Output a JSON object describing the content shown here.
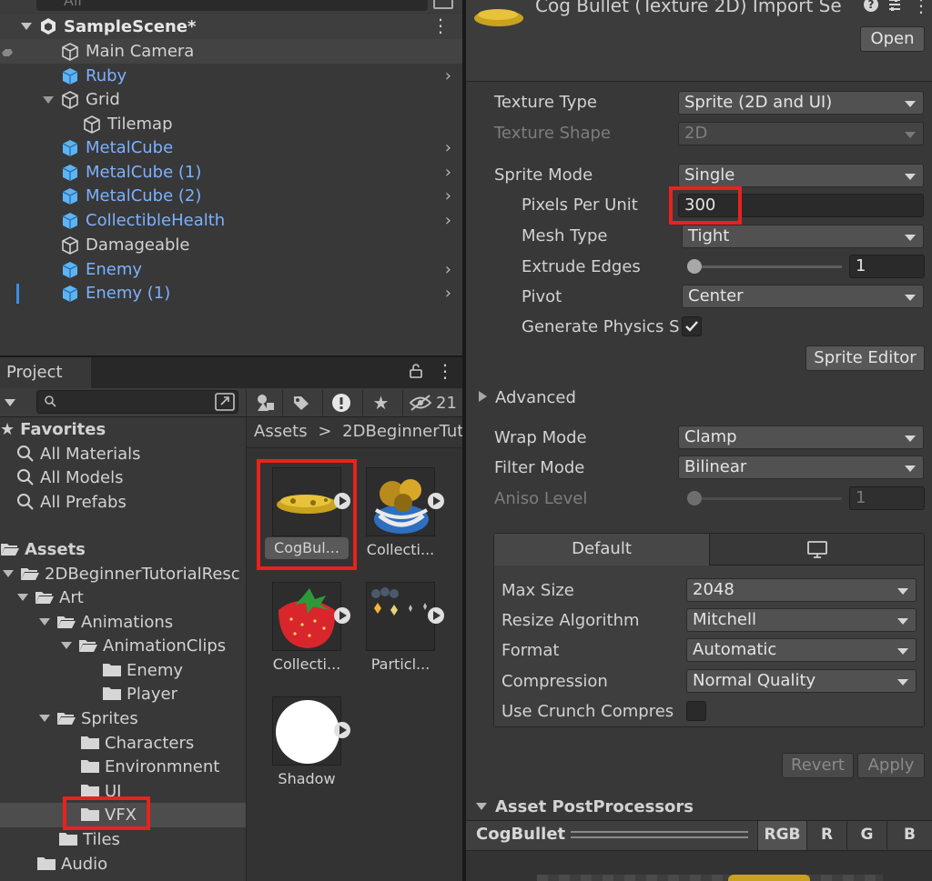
{
  "hierarchy": {
    "search_placeholder": "All",
    "scene": "SampleScene*",
    "items": [
      {
        "label": "Main Camera",
        "prefab": false
      },
      {
        "label": "Ruby",
        "prefab": true
      },
      {
        "label": "Grid",
        "prefab": false
      },
      {
        "label": "Tilemap",
        "prefab": false
      },
      {
        "label": "MetalCube",
        "prefab": true
      },
      {
        "label": "MetalCube (1)",
        "prefab": true
      },
      {
        "label": "MetalCube (2)",
        "prefab": true
      },
      {
        "label": "CollectibleHealth",
        "prefab": true
      },
      {
        "label": "Damageable",
        "prefab": false
      },
      {
        "label": "Enemy",
        "prefab": true
      },
      {
        "label": "Enemy (1)",
        "prefab": true
      }
    ]
  },
  "project": {
    "tab": "Project",
    "hidden_count": "21",
    "favorites": {
      "label": "Favorites",
      "items": [
        "All Materials",
        "All Models",
        "All Prefabs"
      ]
    },
    "tree": {
      "assets": "Assets",
      "items": [
        "2DBeginnerTutorialResc",
        "Art",
        "Animations",
        "AnimationClips",
        "Enemy",
        "Player",
        "Sprites",
        "Characters",
        "Environmnent",
        "UI",
        "VFX",
        "Tiles",
        "Audio"
      ]
    },
    "breadcrumb": {
      "root": "Assets",
      "sep": ">",
      "path": "2DBeginnerTut"
    },
    "assets": [
      {
        "label": "CogBul..."
      },
      {
        "label": "Collecti..."
      },
      {
        "label": "Collecti..."
      },
      {
        "label": "Particl..."
      },
      {
        "label": "Shadow"
      }
    ]
  },
  "inspector": {
    "title": "Cog Bullet (Texture 2D) Import Se",
    "open_label": "Open",
    "texture_type": {
      "label": "Texture Type",
      "value": "Sprite (2D and UI)"
    },
    "texture_shape": {
      "label": "Texture Shape",
      "value": "2D"
    },
    "sprite_mode": {
      "label": "Sprite Mode",
      "value": "Single"
    },
    "pixels_per_unit": {
      "label": "Pixels Per Unit",
      "value": "300"
    },
    "mesh_type": {
      "label": "Mesh Type",
      "value": "Tight"
    },
    "extrude_edges": {
      "label": "Extrude Edges",
      "value": "1"
    },
    "pivot": {
      "label": "Pivot",
      "value": "Center"
    },
    "generate_physics": {
      "label": "Generate Physics S",
      "checked": true
    },
    "sprite_editor_label": "Sprite Editor",
    "advanced_label": "Advanced",
    "wrap_mode": {
      "label": "Wrap Mode",
      "value": "Clamp"
    },
    "filter_mode": {
      "label": "Filter Mode",
      "value": "Bilinear"
    },
    "aniso_level": {
      "label": "Aniso Level",
      "value": "1"
    },
    "platform": {
      "default_tab": "Default",
      "max_size": {
        "label": "Max Size",
        "value": "2048"
      },
      "resize_algorithm": {
        "label": "Resize Algorithm",
        "value": "Mitchell"
      },
      "format": {
        "label": "Format",
        "value": "Automatic"
      },
      "compression": {
        "label": "Compression",
        "value": "Normal Quality"
      },
      "use_crunch": {
        "label": "Use Crunch Compres",
        "checked": false
      }
    },
    "revert_label": "Revert",
    "apply_label": "Apply",
    "postprocessors_label": "Asset PostProcessors",
    "preview": {
      "name": "CogBullet",
      "channels": [
        "RGB",
        "R",
        "G",
        "B"
      ]
    }
  },
  "colors": {
    "prefab_blue": "#7cb1ff",
    "highlight_red": "#e8221e"
  }
}
